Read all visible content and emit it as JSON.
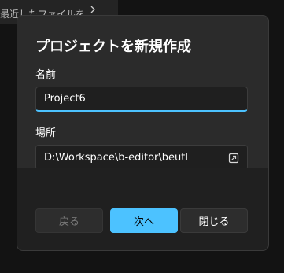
{
  "background": {
    "menu_item_text": "最近したファイルを開く",
    "chevron_icon": "chevron-right-icon"
  },
  "dialog": {
    "title": "プロジェクトを新規作成",
    "name_label": "名前",
    "name_value": "Project6",
    "location_label": "場所",
    "location_value": "D:\\Workspace\\b-editor\\beutl",
    "browse_icon": "open-folder-icon",
    "buttons": {
      "back": "戻る",
      "next": "次へ",
      "close": "閉じる"
    }
  },
  "colors": {
    "accent": "#4cc2ff",
    "dialog_bg": "#2b2b2b",
    "footer_bg": "#202020",
    "input_bg": "#1f1f1f"
  }
}
